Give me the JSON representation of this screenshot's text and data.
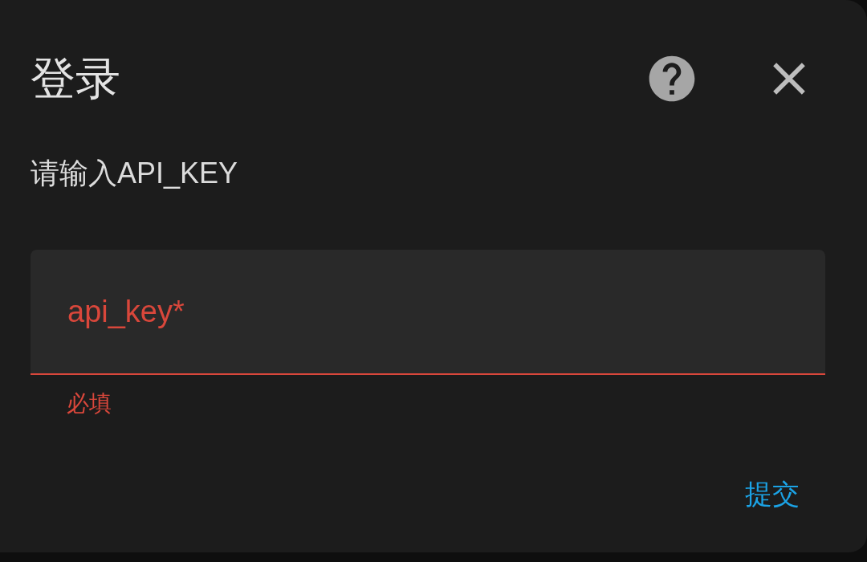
{
  "dialog": {
    "title": "登录",
    "prompt": "请输入API_KEY",
    "field": {
      "placeholder": "api_key*",
      "invalid": true,
      "helper_text": "必填"
    },
    "actions": [
      "提交"
    ]
  }
}
